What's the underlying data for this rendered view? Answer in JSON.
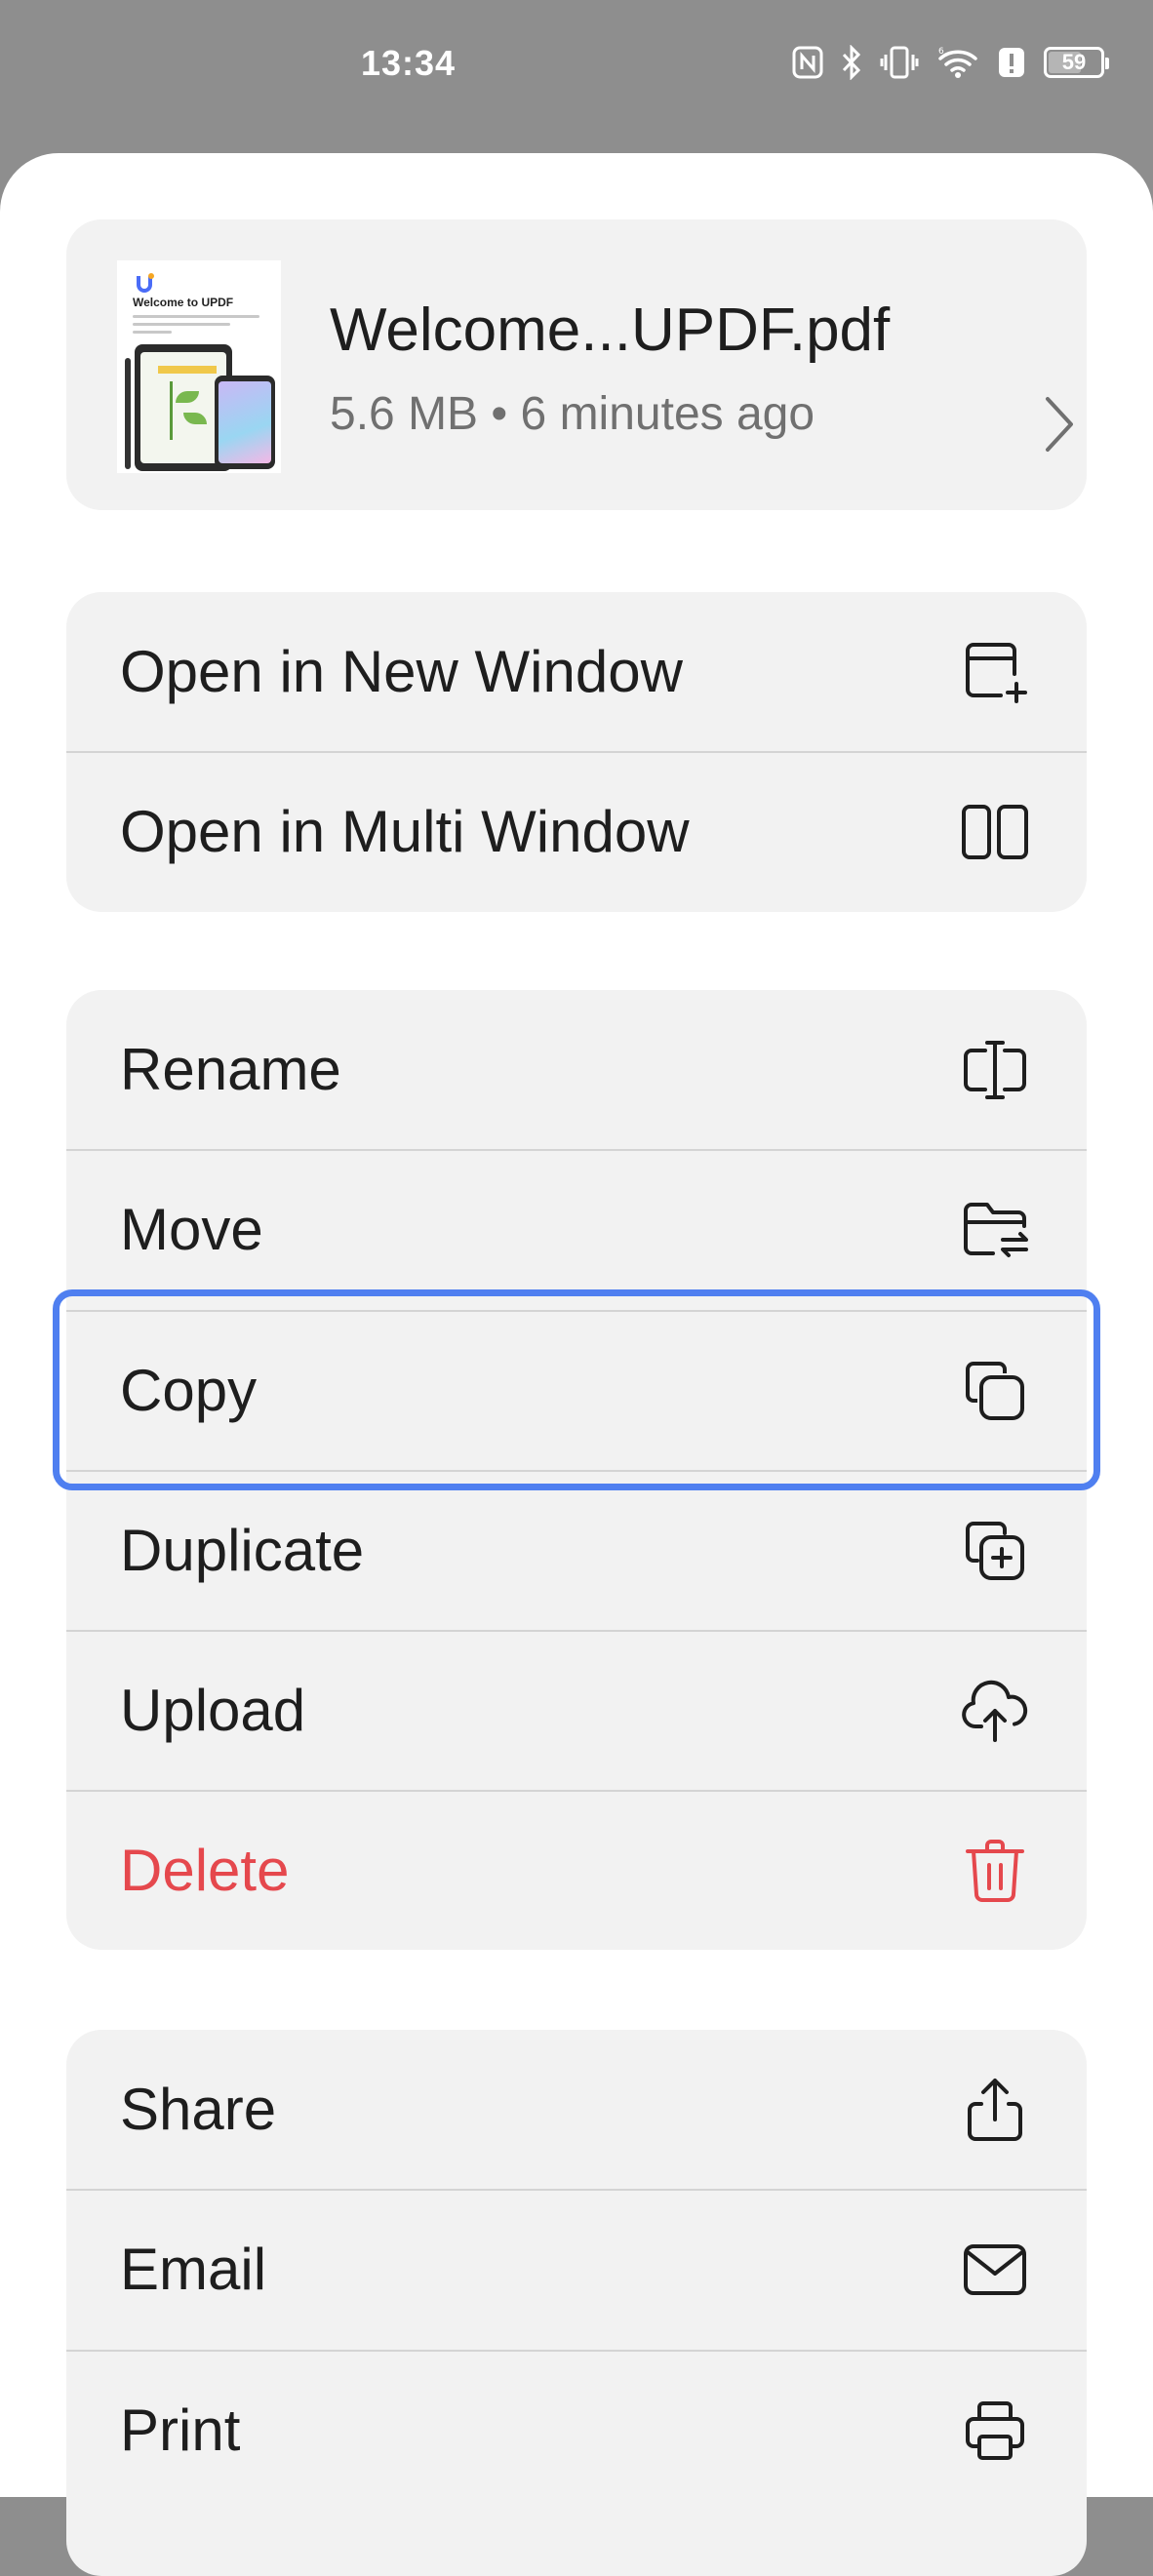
{
  "status_bar": {
    "time": "13:34",
    "battery": "59",
    "battery_level": 0.59,
    "icons": [
      "nfc-icon",
      "bluetooth-icon",
      "vibrate-icon",
      "wifi-icon",
      "alert-icon",
      "battery-icon"
    ]
  },
  "file": {
    "name": "Welcome...UPDF.pdf",
    "meta": "5.6 MB • 6 minutes ago",
    "thumbnail_title": "Welcome to UPDF"
  },
  "groups": [
    {
      "items": [
        {
          "label": "Open in New Window",
          "icon": "new-window-icon"
        },
        {
          "label": "Open in Multi Window",
          "icon": "multi-window-icon"
        }
      ]
    },
    {
      "items": [
        {
          "label": "Rename",
          "icon": "rename-icon"
        },
        {
          "label": "Move",
          "icon": "move-folder-icon"
        },
        {
          "label": "Copy",
          "icon": "copy-icon"
        },
        {
          "label": "Duplicate",
          "icon": "duplicate-icon"
        },
        {
          "label": "Upload",
          "icon": "cloud-upload-icon"
        },
        {
          "label": "Delete",
          "icon": "trash-icon"
        }
      ]
    },
    {
      "items": [
        {
          "label": "Share",
          "icon": "share-icon"
        },
        {
          "label": "Email",
          "icon": "email-icon"
        },
        {
          "label": "Print",
          "icon": "printer-icon"
        }
      ]
    }
  ],
  "colors": {
    "accent_highlight": "#4f7ff0",
    "danger": "#e5484d",
    "card_bg": "#f2f2f2",
    "scrim": "#8e8e8e"
  }
}
